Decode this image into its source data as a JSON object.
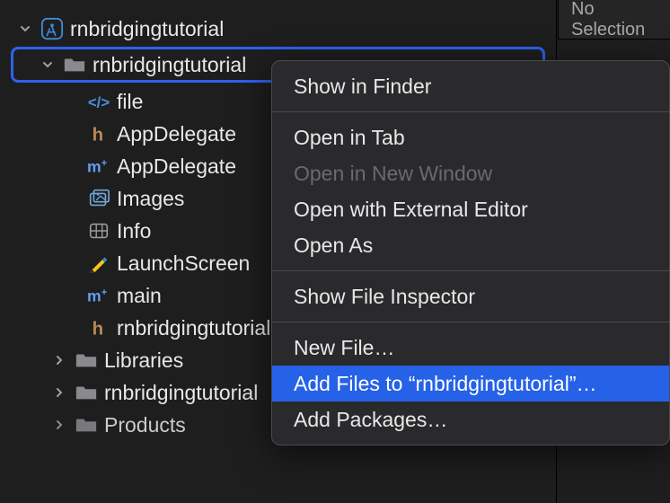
{
  "rightPanel": {
    "title": "No Selection"
  },
  "tree": {
    "project": "rnbridgingtutorial",
    "folder": "rnbridgingtutorial",
    "children": [
      {
        "label": "file"
      },
      {
        "label": "AppDelegate"
      },
      {
        "label": "AppDelegate"
      },
      {
        "label": "Images"
      },
      {
        "label": "Info"
      },
      {
        "label": "LaunchScreen"
      },
      {
        "label": "main"
      },
      {
        "label": "rnbridgingtutorial"
      }
    ],
    "siblings": [
      {
        "label": "Libraries"
      },
      {
        "label": "rnbridgingtutorial"
      },
      {
        "label": "Products"
      }
    ]
  },
  "menu": {
    "items": [
      {
        "label": "Show in Finder"
      },
      {
        "sep": true
      },
      {
        "label": "Open in Tab"
      },
      {
        "label": "Open in New Window",
        "disabled": true
      },
      {
        "label": "Open with External Editor"
      },
      {
        "label": "Open As"
      },
      {
        "sep": true
      },
      {
        "label": "Show File Inspector"
      },
      {
        "sep": true
      },
      {
        "label": "New File…"
      },
      {
        "label": "Add Files to “rnbridgingtutorial”…",
        "highlight": true
      },
      {
        "label": "Add Packages…"
      }
    ]
  }
}
